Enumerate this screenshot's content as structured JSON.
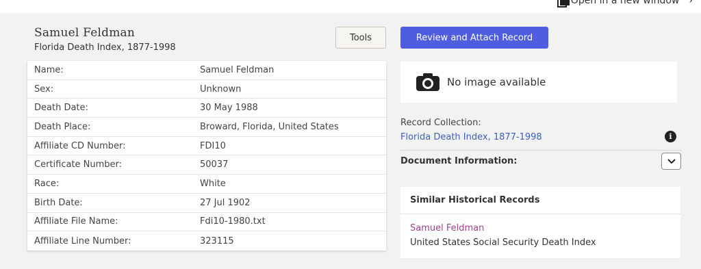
{
  "topbar": {
    "open_new_window": "Open in a new window",
    "chevron": "›"
  },
  "record": {
    "name": "Samuel Feldman",
    "collection": "Florida Death Index, 1877-1998"
  },
  "buttons": {
    "tools": "Tools",
    "review": "Review and Attach Record"
  },
  "facts": [
    {
      "label": "Name:",
      "value": "Samuel Feldman"
    },
    {
      "label": "Sex:",
      "value": "Unknown"
    },
    {
      "label": "Death Date:",
      "value": "30 May 1988"
    },
    {
      "label": "Death Place:",
      "value": "Broward, Florida, United States"
    },
    {
      "label": "Affiliate CD Number:",
      "value": "FDI10"
    },
    {
      "label": "Certificate Number:",
      "value": "50037"
    },
    {
      "label": "Race:",
      "value": "White"
    },
    {
      "label": "Birth Date:",
      "value": "27 Jul 1902"
    },
    {
      "label": "Affiliate File Name:",
      "value": "Fdi10-1980.txt"
    },
    {
      "label": "Affiliate Line Number:",
      "value": "323115"
    }
  ],
  "image_panel": {
    "text": "No image available",
    "icon": "camera-icon"
  },
  "record_collection": {
    "label": "Record Collection:",
    "link": "Florida Death Index, 1877-1998",
    "info_icon": "info-icon"
  },
  "document_info": {
    "label": "Document Information:",
    "toggle_icon": "chevron-down-icon"
  },
  "similar": {
    "title": "Similar Historical Records",
    "items": [
      {
        "name": "Samuel Feldman",
        "collection": "United States Social Security Death Index"
      }
    ]
  },
  "colors": {
    "primary_button": "#4f5ee0",
    "link_blue": "#3b5fc0",
    "link_magenta": "#a2408f",
    "page_bg": "#f2f2f2"
  }
}
